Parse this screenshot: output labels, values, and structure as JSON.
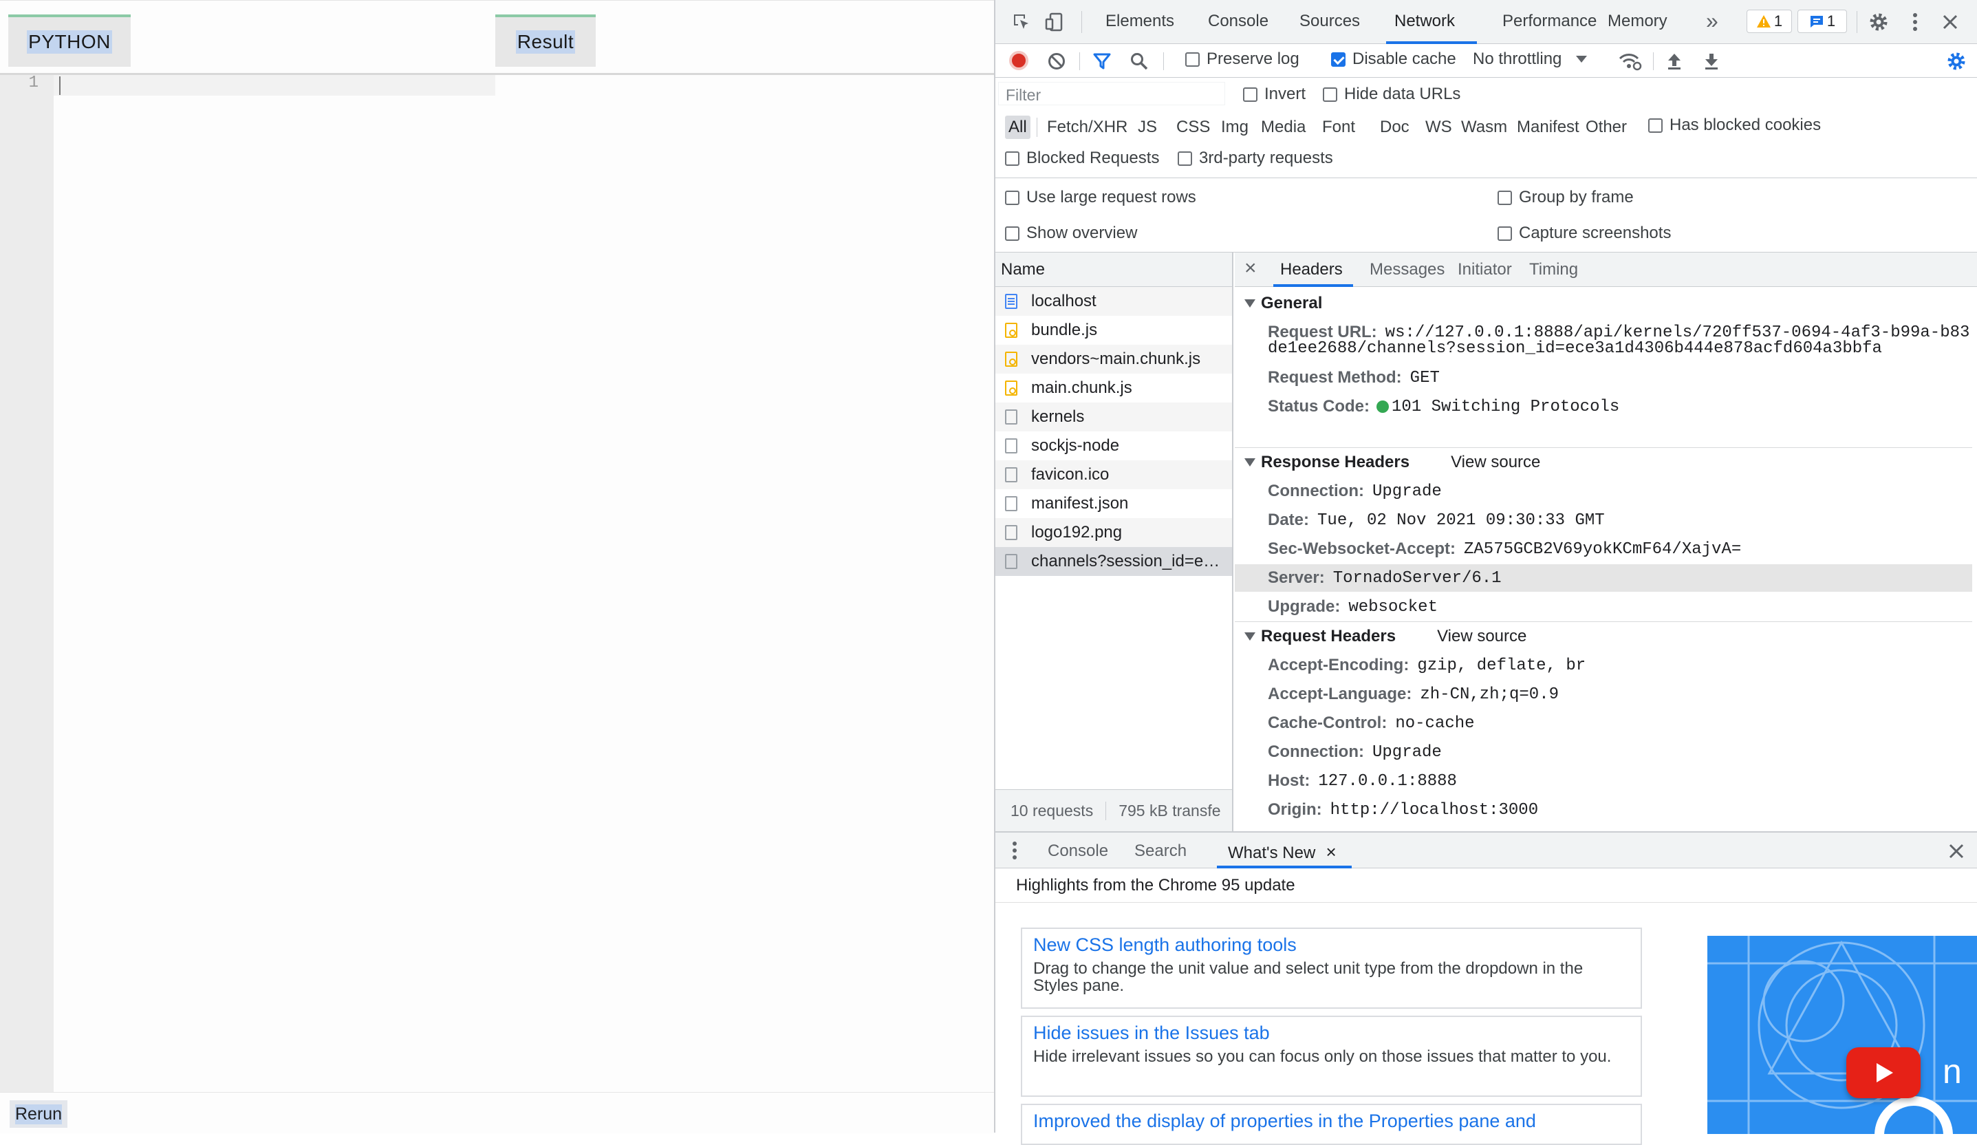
{
  "app": {
    "tab_python": "PYTHON",
    "tab_result": "Result",
    "line_number": "1",
    "rerun_label": "Rerun"
  },
  "devtools": {
    "main_tabs": [
      "Elements",
      "Console",
      "Sources",
      "Network",
      "Performance",
      "Memory"
    ],
    "active_tab": "Network",
    "more_tabs_label": "»",
    "warnings_count": "1",
    "messages_count": "1",
    "toolbar": {
      "preserve_log_label": "Preserve log",
      "preserve_log_checked": false,
      "disable_cache_label": "Disable cache",
      "disable_cache_checked": true,
      "throttling_value": "No throttling"
    },
    "filter": {
      "placeholder": "Filter",
      "invert_label": "Invert",
      "hide_data_urls_label": "Hide data URLs",
      "types": [
        "All",
        "Fetch/XHR",
        "JS",
        "CSS",
        "Img",
        "Media",
        "Font",
        "Doc",
        "WS",
        "Wasm",
        "Manifest",
        "Other"
      ],
      "active_type": "All",
      "has_blocked_cookies_label": "Has blocked cookies",
      "blocked_requests_label": "Blocked Requests",
      "third_party_label": "3rd-party requests"
    },
    "settings": {
      "large_rows_label": "Use large request rows",
      "group_by_frame_label": "Group by frame",
      "show_overview_label": "Show overview",
      "capture_screenshots_label": "Capture screenshots"
    },
    "requests": {
      "header": "Name",
      "items": [
        {
          "name": "localhost",
          "icon": "document-icon"
        },
        {
          "name": "bundle.js",
          "icon": "script-icon"
        },
        {
          "name": "vendors~main.chunk.js",
          "icon": "script-icon"
        },
        {
          "name": "main.chunk.js",
          "icon": "script-icon"
        },
        {
          "name": "kernels",
          "icon": "file-icon"
        },
        {
          "name": "sockjs-node",
          "icon": "file-icon"
        },
        {
          "name": "favicon.ico",
          "icon": "file-icon"
        },
        {
          "name": "manifest.json",
          "icon": "file-icon"
        },
        {
          "name": "logo192.png",
          "icon": "file-icon"
        },
        {
          "name": "channels?session_id=e…",
          "icon": "file-icon"
        }
      ],
      "summary_requests": "10 requests",
      "summary_transfer": "795 kB transfe"
    },
    "detail": {
      "close_glyph": "×",
      "tabs": [
        "Headers",
        "Messages",
        "Initiator",
        "Timing"
      ],
      "active_tab": "Headers",
      "general": {
        "title": "General",
        "request_url_label": "Request URL:",
        "request_url_value_line1": "ws://127.0.0.1:8888/api/kernels/720ff537-0694-4af3-b99a-b83",
        "request_url_value_line2": "de1ee2688/channels?session_id=ece3a1d4306b444e878acfd604a3bbfa",
        "request_method_label": "Request Method:",
        "request_method_value": "GET",
        "status_code_label": "Status Code:",
        "status_code_value": "101 Switching Protocols",
        "status_color": "#34a853"
      },
      "response_headers": {
        "title": "Response Headers",
        "view_source": "View source",
        "items": [
          {
            "name": "Connection:",
            "value": "Upgrade"
          },
          {
            "name": "Date:",
            "value": "Tue, 02 Nov 2021 09:30:33 GMT"
          },
          {
            "name": "Sec-Websocket-Accept:",
            "value": "ZA575GCB2V69yokKCmF64/XajvA="
          },
          {
            "name": "Server:",
            "value": "TornadoServer/6.1"
          },
          {
            "name": "Upgrade:",
            "value": "websocket"
          }
        ]
      },
      "request_headers": {
        "title": "Request Headers",
        "view_source": "View source",
        "items": [
          {
            "name": "Accept-Encoding:",
            "value": "gzip, deflate, br"
          },
          {
            "name": "Accept-Language:",
            "value": "zh-CN,zh;q=0.9"
          },
          {
            "name": "Cache-Control:",
            "value": "no-cache"
          },
          {
            "name": "Connection:",
            "value": "Upgrade"
          },
          {
            "name": "Host:",
            "value": "127.0.0.1:8888"
          },
          {
            "name": "Origin:",
            "value": "http://localhost:3000"
          }
        ]
      }
    },
    "drawer": {
      "tabs": [
        "Console",
        "Search",
        "What's New"
      ],
      "active_tab": "What's New",
      "headline": "Highlights from the Chrome 95 update",
      "cards": [
        {
          "title": "New CSS length authoring tools",
          "desc": "Drag to change the unit value and select unit type from the dropdown in the Styles pane."
        },
        {
          "title": "Hide issues in the Issues tab",
          "desc": "Hide irrelevant issues so you can focus only on those issues that matter to you."
        },
        {
          "title": "Improved the display of properties in the Properties pane and",
          "desc": ""
        }
      ],
      "video_text": "n"
    },
    "colors": {
      "accent": "#1a73e8",
      "record": "#d93025",
      "active_tab_underline": "#1a73e8"
    }
  }
}
